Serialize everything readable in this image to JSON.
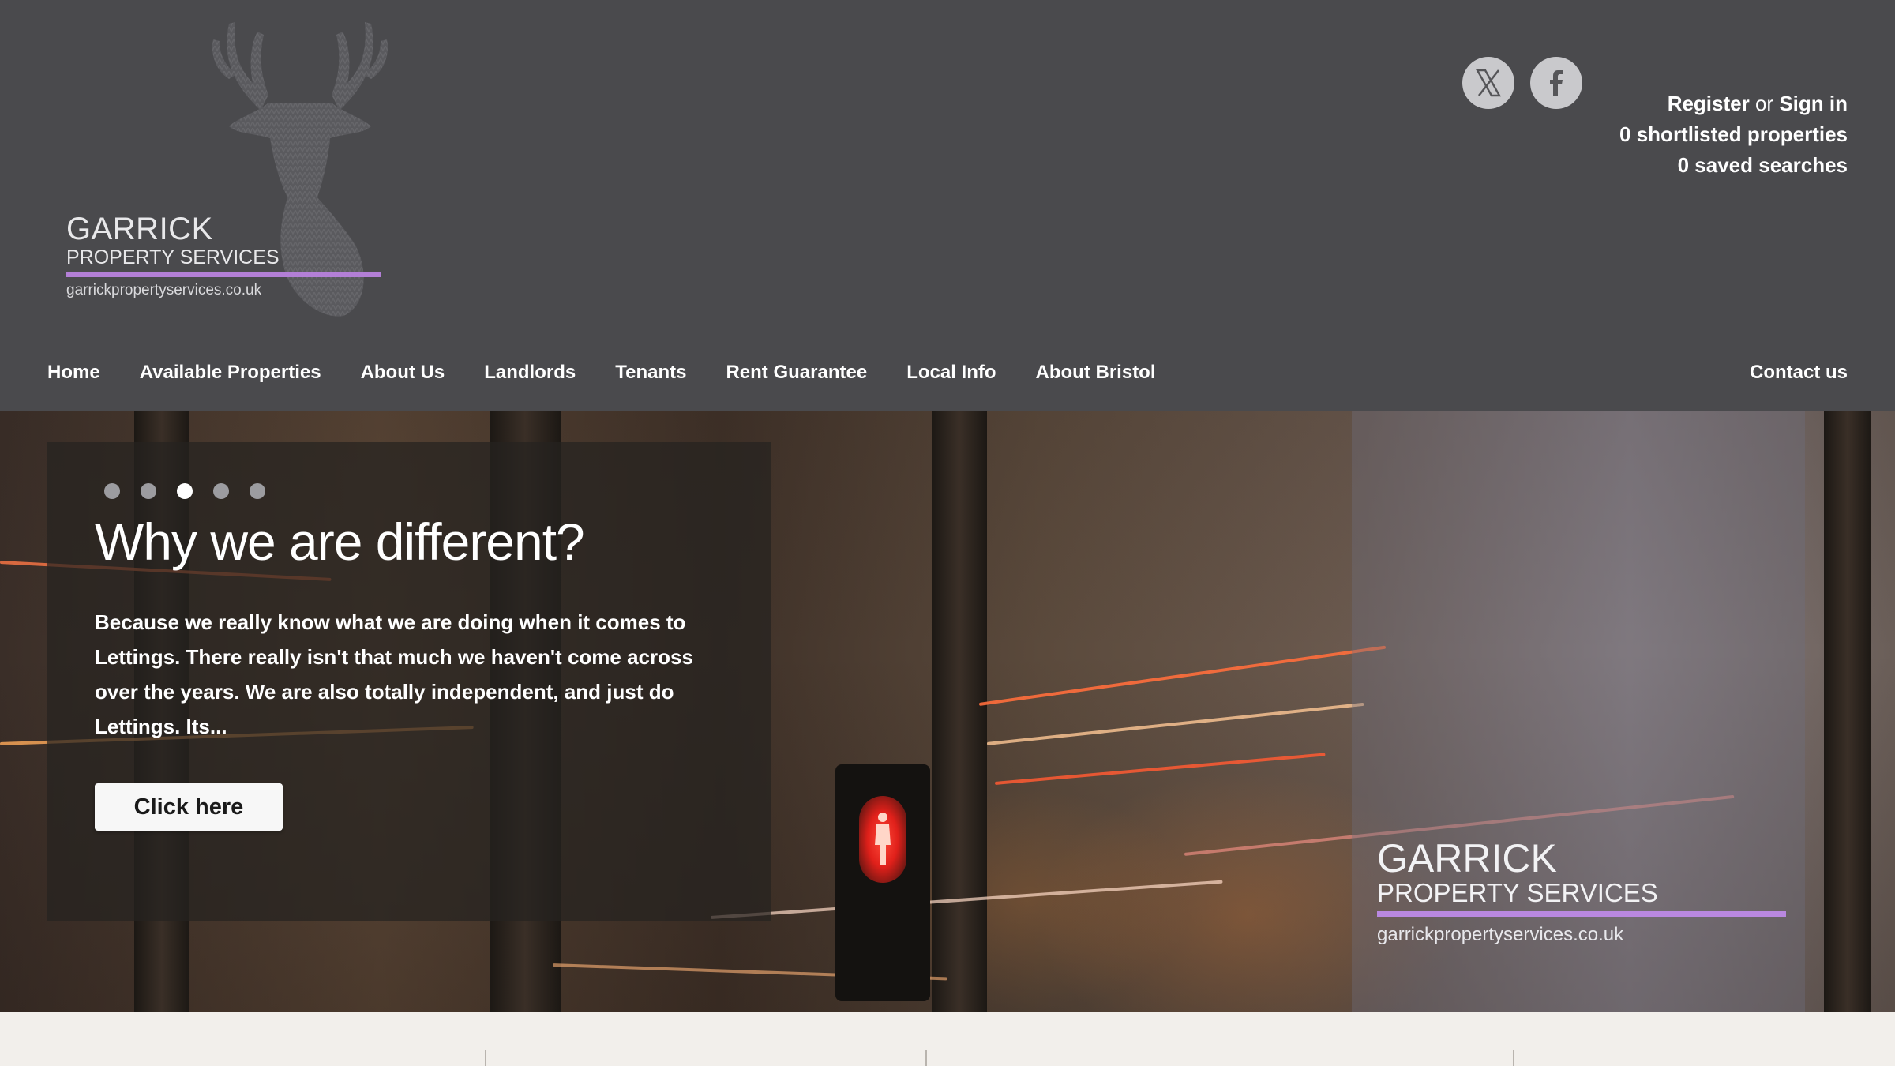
{
  "brand": {
    "name": "GARRICK",
    "subtitle": "PROPERTY SERVICES",
    "url": "garrickpropertyservices.co.uk",
    "accent_color": "#b37fd6"
  },
  "social": {
    "x_icon": "x-twitter-icon",
    "facebook_icon": "facebook-icon"
  },
  "account": {
    "register": "Register",
    "or": "or",
    "sign_in": "Sign in",
    "shortlisted": "0 shortlisted properties",
    "saved_searches": "0 saved searches"
  },
  "nav": {
    "items": [
      "Home",
      "Available Properties",
      "About Us",
      "Landlords",
      "Tenants",
      "Rent Guarantee",
      "Local Info",
      "About Bristol"
    ],
    "contact": "Contact us"
  },
  "hero": {
    "slide_count": 5,
    "active_slide": 3,
    "title": "Why we are different?",
    "text": "Because we really know what we are doing when it comes to Lettings. There really isn't that much we haven't come across over the years. We are also totally independent, and just do Lettings. Its...",
    "cta": "Click here",
    "overlay_brand": {
      "name": "GARRICK",
      "subtitle": "PROPERTY SERVICES",
      "url": "garrickpropertyservices.co.uk"
    }
  },
  "colors": {
    "header_bg": "#4a4a4d",
    "strip_bg": "#f2efeb"
  }
}
